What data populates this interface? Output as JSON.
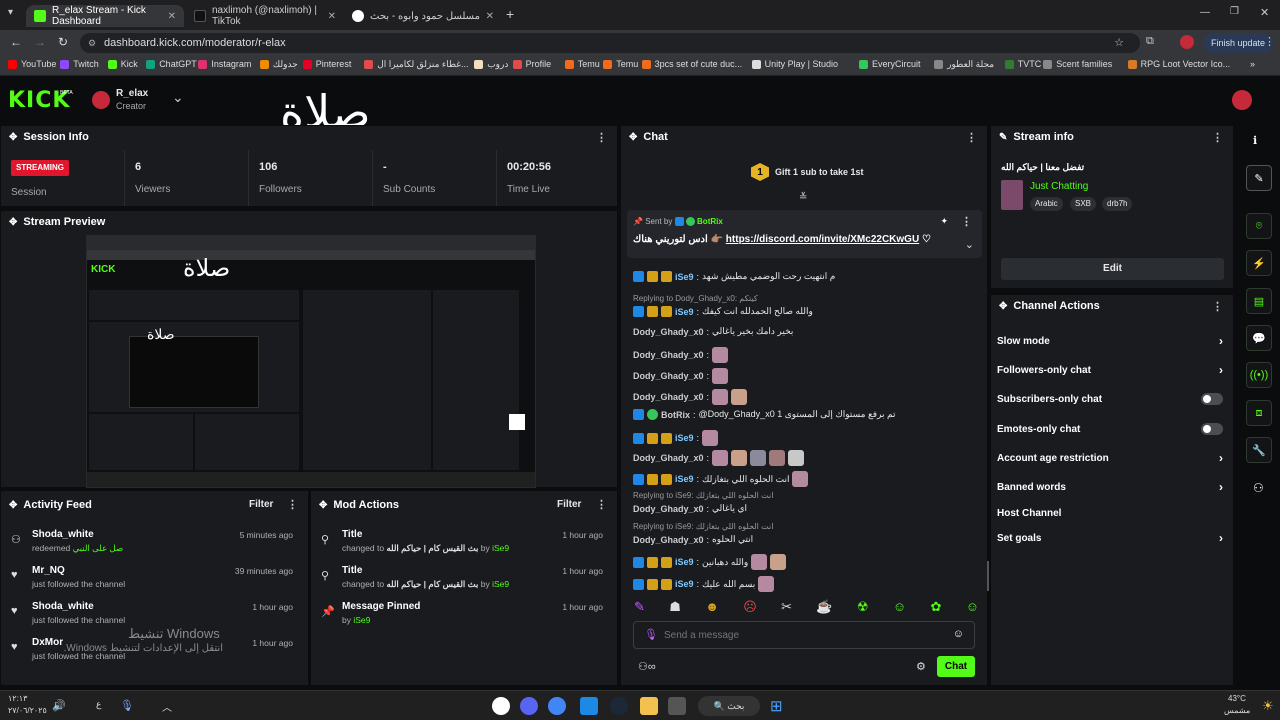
{
  "browser": {
    "tabs": [
      {
        "label": "R_elax Stream - Kick Dashboard",
        "color": "#53fc18"
      },
      {
        "label": "naxlimoh (@naxlimoh) | TikTok",
        "color": "#111111"
      },
      {
        "label": "مسلسل حمود وابوه - بحث Google",
        "color": "#4285f4"
      }
    ],
    "url": "dashboard.kick.com/moderator/r-elax",
    "finish_update": "Finish update",
    "bookmarks": [
      "YouTube",
      "Twitch",
      "Kick",
      "ChatGPT",
      "Instagram",
      "جدولك",
      "Pinterest",
      "غطاء منزلق لكاميرا ال...",
      "دروب",
      "Profile",
      "Temu",
      "Temu",
      "3pcs set of cute duc...",
      "Unity Play | Studio",
      "EveryCircuit",
      "مجلة العطور",
      "TVTC",
      "Scent families",
      "RPG Loot Vector Ico..."
    ]
  },
  "header": {
    "logo": "KICK",
    "logo_badge": "BETA",
    "channel_name": "R_elax",
    "role": "Creator",
    "overlay_text": "صلاة"
  },
  "session": {
    "title": "Session Info",
    "status": "STREAMING",
    "status_label": "Session",
    "stats": [
      {
        "value": "6",
        "label": "Viewers"
      },
      {
        "value": "106",
        "label": "Followers"
      },
      {
        "value": "-",
        "label": "Sub Counts"
      },
      {
        "value": "00:20:56",
        "label": "Time Live"
      }
    ]
  },
  "preview": {
    "title": "Stream Preview",
    "overlay_text": "صلاة"
  },
  "activity": {
    "title": "Activity Feed",
    "filter": "Filter",
    "items": [
      {
        "name": "Shoda_white",
        "sub": "redeemed",
        "sub_highlight": "صل على النبي",
        "time": "5 minutes ago"
      },
      {
        "name": "Mr_NQ",
        "sub": "just followed the channel",
        "time": "39 minutes ago"
      },
      {
        "name": "Shoda_white",
        "sub": "just followed the channel",
        "time": "1 hour ago"
      },
      {
        "name": "DxMor",
        "sub": "just followed the channel",
        "time": "1 hour ago"
      }
    ]
  },
  "mod": {
    "title": "Mod Actions",
    "filter": "Filter",
    "items": [
      {
        "name": "Title",
        "sub": "changed to",
        "value": "بث القيس كام | حياكم الله",
        "by": "by",
        "user": "iSe9",
        "time": "1 hour ago"
      },
      {
        "name": "Title",
        "sub": "changed to",
        "value": "بث القيس كام | حياكم الله",
        "by": "by",
        "user": "iSe9",
        "time": "1 hour ago"
      },
      {
        "name": "Message Pinned",
        "sub": "by",
        "user": "iSe9",
        "time": "1 hour ago"
      }
    ]
  },
  "watermark": {
    "line1": "تنشيط Windows",
    "line2": "انتقل إلى الإعدادات لتنشيط Windows."
  },
  "chat": {
    "title": "Chat",
    "gift_count": "1",
    "gift_text": "Gift 1 sub to take 1st",
    "pinned_sent_by": "Sent by",
    "pinned_user": "BotRix",
    "pinned_text": "ادس لتوريني هناك",
    "pinned_link": "https://discord.com/invite/XMc22CKwGU",
    "messages": [
      {
        "user": "iSe9",
        "text": "م انتهيت رحت الوضمي مطيش شهد",
        "badges": 3
      },
      {
        "reply": "Replying to Dody_Ghady_x0: كيتكم"
      },
      {
        "user": "iSe9",
        "text": "والله صالح الحمدلله انت كيفك",
        "badges": 3
      },
      {
        "user": "Dody_Ghady_x0",
        "text": "بخير دامك بخير ياغالي",
        "badges": 0
      },
      {
        "user": "Dody_Ghady_x0",
        "text": "",
        "badges": 0,
        "emotes": 1
      },
      {
        "user": "Dody_Ghady_x0",
        "text": "",
        "badges": 0,
        "emotes": 1
      },
      {
        "user": "Dody_Ghady_x0",
        "text": "",
        "badges": 0,
        "emotes": 2
      },
      {
        "user": "BotRix",
        "text": "@Dody_Ghady_x0 تم برفع مستواك إلى المستوى 1",
        "badges": 2
      },
      {
        "user": "iSe9",
        "text": "",
        "badges": 3,
        "emotes": 1
      },
      {
        "user": "Dody_Ghady_x0",
        "text": "",
        "badges": 0,
        "emotes": 5
      },
      {
        "user": "iSe9",
        "text": "انت الحلوه اللي بتغازلك",
        "badges": 3,
        "emotes": 1
      },
      {
        "reply": "Replying to iSe9: انت الحلوه اللي بتغازلك"
      },
      {
        "user": "Dody_Ghady_x0",
        "text": "اي ياغالي",
        "badges": 0
      },
      {
        "reply": "Replying to iSe9: انت الحلوه اللي بتغازلك"
      },
      {
        "user": "Dody_Ghady_x0",
        "text": "انتي الحلوه",
        "badges": 0
      },
      {
        "user": "iSe9",
        "text": "والله دهبانين",
        "badges": 3,
        "emotes": 2
      },
      {
        "user": "iSe9",
        "text": "بسم الله عليك",
        "badges": 3,
        "emotes": 1
      }
    ],
    "input_placeholder": "Send a message",
    "send_label": "Chat"
  },
  "stream_info": {
    "title": "Stream info",
    "stream_title": "تفضل معنا | حياكم الله",
    "category": "Just Chatting",
    "tags": [
      "Arabic",
      "SXB",
      "drb7h"
    ],
    "edit_label": "Edit"
  },
  "channel_actions": {
    "title": "Channel Actions",
    "items": [
      {
        "label": "Slow mode",
        "control": "chevron"
      },
      {
        "label": "Followers-only chat",
        "control": "chevron"
      },
      {
        "label": "Subscribers-only chat",
        "control": "toggle"
      },
      {
        "label": "Emotes-only chat",
        "control": "toggle"
      },
      {
        "label": "Account age restriction",
        "control": "chevron"
      },
      {
        "label": "Banned words",
        "control": "chevron"
      },
      {
        "label": "Host Channel",
        "control": "none"
      },
      {
        "label": "Set goals",
        "control": "chevron"
      }
    ]
  },
  "taskbar": {
    "search": "بحث",
    "time": "١٢:١٣",
    "date": "٢٧/٠٦/٢٠٢٥",
    "weather_temp": "43°C",
    "weather_desc": "مشمس",
    "lang": "ع"
  },
  "colors": {
    "accent": "#53fc18",
    "bg": "#0b0c0d",
    "panel": "#191b1f",
    "streaming": "#e1162c"
  }
}
